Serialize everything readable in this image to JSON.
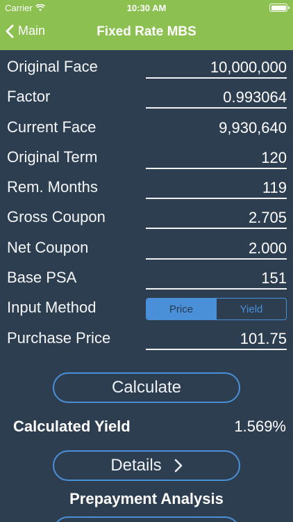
{
  "status": {
    "carrier": "Carrier",
    "time": "10:30 AM"
  },
  "nav": {
    "back_label": "Main",
    "title": "Fixed Rate MBS"
  },
  "fields": [
    {
      "label": "Original Face",
      "value": "10,000,000"
    },
    {
      "label": "Factor",
      "value": "0.993064"
    },
    {
      "label": "Current Face",
      "value": "9,930,640"
    },
    {
      "label": "Original Term",
      "value": "120"
    },
    {
      "label": "Rem. Months",
      "value": "119"
    },
    {
      "label": "Gross Coupon",
      "value": "2.705"
    },
    {
      "label": "Net Coupon",
      "value": "2.000"
    },
    {
      "label": "Base PSA",
      "value": "151"
    }
  ],
  "input_method": {
    "label": "Input Method",
    "options": [
      "Price",
      "Yield"
    ],
    "selected": "Price"
  },
  "purchase_price": {
    "label": "Purchase Price",
    "value": "101.75"
  },
  "calculate_label": "Calculate",
  "result": {
    "label": "Calculated Yield",
    "value": "1.569%"
  },
  "details_label": "Details",
  "prepayment_label": "Prepayment Analysis",
  "colors": {
    "accent": "#8cc152",
    "background": "#2e3e51",
    "button_border": "#4a90d9"
  }
}
